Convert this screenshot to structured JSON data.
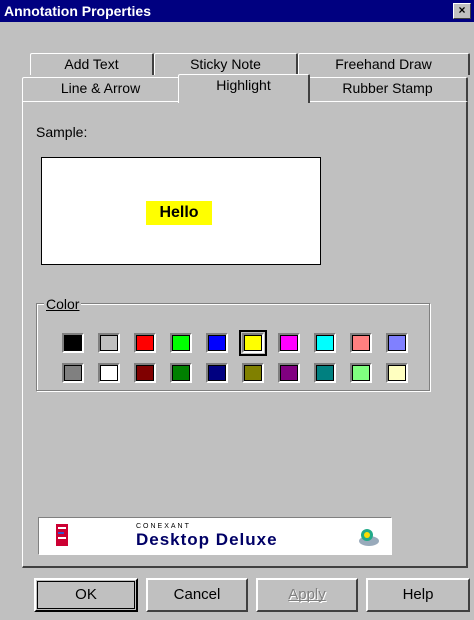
{
  "window": {
    "title": "Annotation Properties",
    "close_glyph": "×"
  },
  "tabs": {
    "row1": [
      "Add Text",
      "Sticky Note",
      "Freehand Draw"
    ],
    "row2": [
      "Line & Arrow",
      "Highlight",
      "Rubber Stamp"
    ],
    "active": "Highlight"
  },
  "sample": {
    "label": "Sample:",
    "text": "Hello",
    "highlight_color": "#ffff00"
  },
  "color_group": {
    "label": "Color"
  },
  "colors": {
    "row1": [
      "#000000",
      "#c0c0c0",
      "#ff0000",
      "#00ff00",
      "#0000ff",
      "#ffff00",
      "#ff00ff",
      "#00ffff",
      "#ff8080",
      "#8080ff"
    ],
    "row2": [
      "#808080",
      "#ffffff",
      "#800000",
      "#008000",
      "#000080",
      "#808000",
      "#800080",
      "#008080",
      "#80ff80",
      "#ffffc0"
    ],
    "selected": "#ffff00"
  },
  "logo": {
    "brand": "CONEXANT",
    "product": "Desktop Deluxe"
  },
  "buttons": {
    "ok": "OK",
    "cancel": "Cancel",
    "apply": "Apply",
    "help": "Help"
  }
}
